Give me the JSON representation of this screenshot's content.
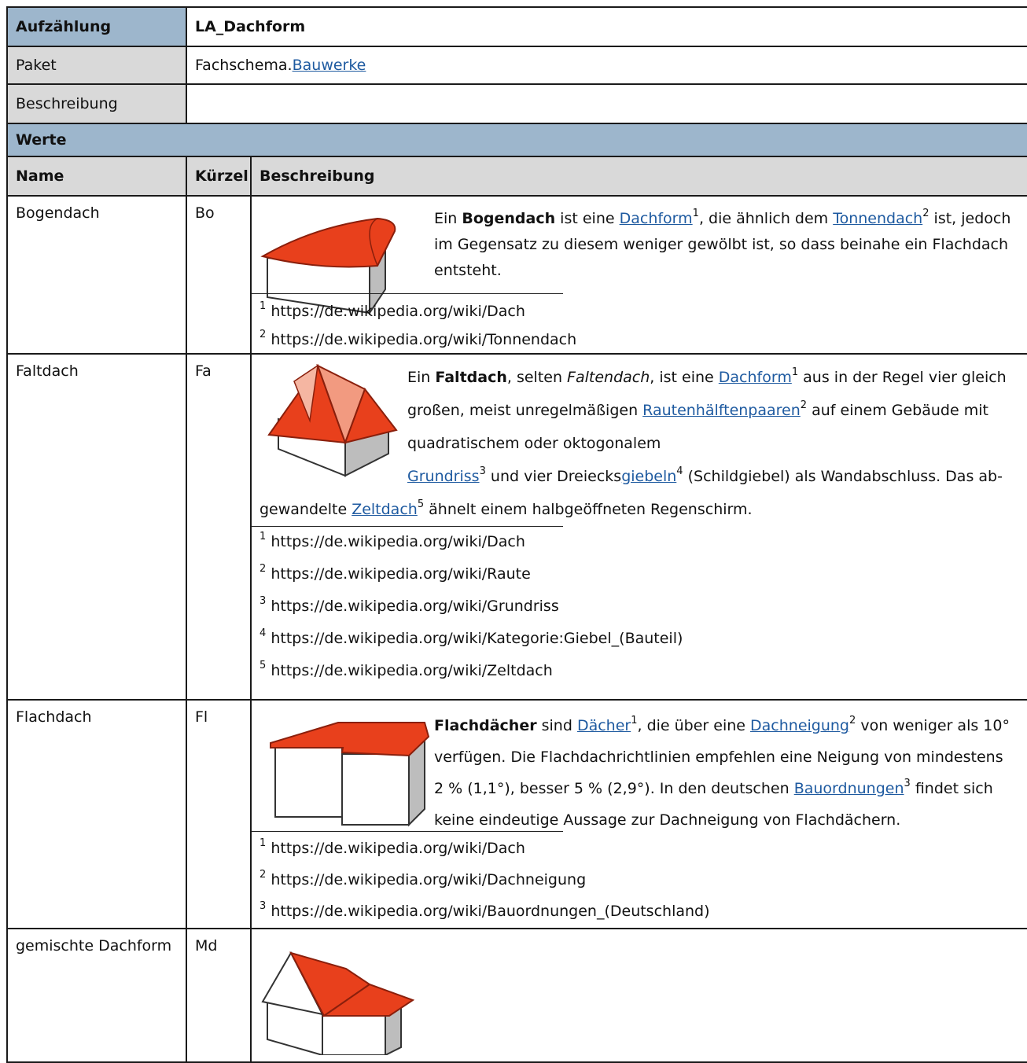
{
  "header": {
    "label": "Aufzählung",
    "value": "LA_Dachform"
  },
  "paket": {
    "label": "Paket",
    "prefix": "Fachschema.",
    "link": "Bauwerke"
  },
  "beschreibung": {
    "label": "Beschreibung",
    "value": ""
  },
  "werte": {
    "label": "Werte",
    "columns": [
      "Name",
      "Kürzel",
      "Beschreibung"
    ]
  },
  "rows": [
    {
      "name": "Bogendach",
      "code": "Bo",
      "text": {
        "p1": "Ein ",
        "bold": "Bogendach",
        "p2": " ist eine ",
        "link1": "Dachform",
        "p3": ", die ähnlich dem ",
        "link2": "Tonnendach",
        "p4": " ist, jedoch im Gegensatz zu diesem weniger gewölbt ist, so dass beinahe ein Flachdach entsteht."
      },
      "footnotes": [
        "https://de.wikipedia.org/wiki/Dach",
        "https://de.wikipedia.org/wiki/Tonnendach"
      ]
    },
    {
      "name": "Faltdach",
      "code": "Fa",
      "text": {
        "p1": "Ein ",
        "bold": "Faltdach",
        "p2": ", selten ",
        "italic": "Faltendach",
        "p3": ", ist eine ",
        "link1": "Dachform",
        "p4": " aus in der Regel vier gleich",
        "p5": "großen, meist unregelmäßigen ",
        "link2": "Rautenhälftenpaaren",
        "p6": " auf einem Gebäude mit",
        "p7": "quadratischem oder oktogonalem",
        "link3": "Grundriss",
        "p8": " und vier Dreiecks",
        "link4": "giebeln",
        "p9": " (Schildgiebel) als Wandabschluss. Das ab-",
        "p10": "gewandelte ",
        "link5": "Zeltdach",
        "p11": " ähnelt einem halbgeöffneten Regenschirm."
      },
      "footnotes": [
        "https://de.wikipedia.org/wiki/Dach",
        "https://de.wikipedia.org/wiki/Raute",
        "https://de.wikipedia.org/wiki/Grundriss",
        "https://de.wikipedia.org/wiki/Kategorie:Giebel_(Bauteil)",
        "https://de.wikipedia.org/wiki/Zeltdach"
      ]
    },
    {
      "name": "Flachdach",
      "code": "Fl",
      "text": {
        "bold": "Flachdächer",
        "p1": " sind ",
        "link1": "Dächer",
        "p2": ", die über eine ",
        "link2": "Dachneigung",
        "p3": " von weniger als 10°",
        "p4": "verfügen. Die Flachdachrichtlinien empfehlen eine Neigung von mindestens",
        "p5": "2 % (1,1°), besser 5 % (2,9°). In den deutschen ",
        "link3": "Bauordnungen",
        "p6": " findet sich",
        "p7": "keine eindeutige Aussage zur Dachneigung von Flachdächern."
      },
      "footnotes": [
        "https://de.wikipedia.org/wiki/Dach",
        "https://de.wikipedia.org/wiki/Dachneigung",
        "https://de.wikipedia.org/wiki/Bauordnungen_(Deutschland)"
      ]
    },
    {
      "name": "gemischte Dachform",
      "code": "Md"
    }
  ],
  "superscripts": [
    "1",
    "2",
    "3",
    "4",
    "5"
  ],
  "colors": {
    "header_blue": "#9db6cc",
    "header_grey": "#d9d9d9",
    "roof_red": "#e8401c",
    "link": "#1e5aa0"
  }
}
